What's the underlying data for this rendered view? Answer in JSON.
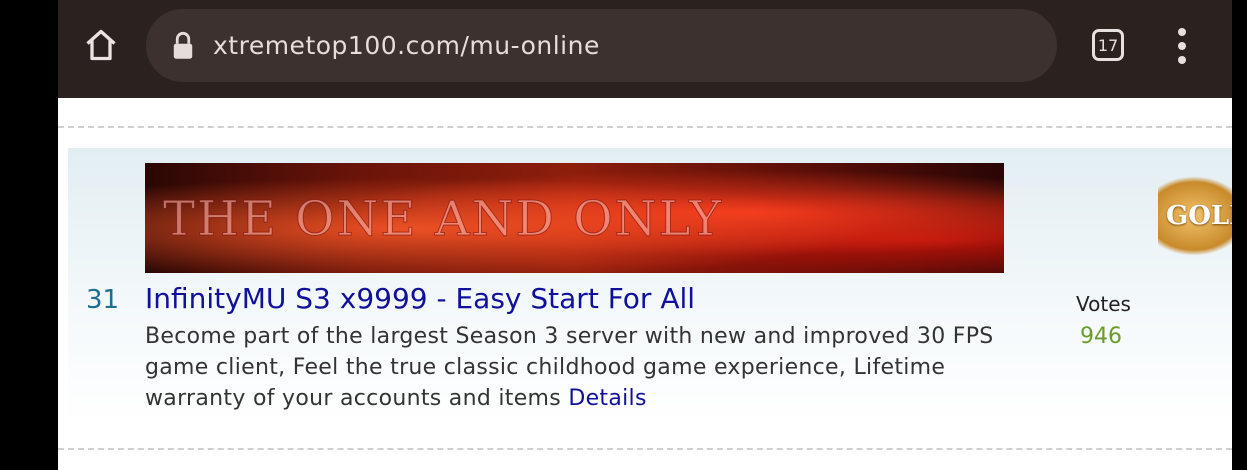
{
  "browser": {
    "url": "xtremetop100.com/mu-online",
    "tab_count": "17",
    "icons": [
      "home-icon",
      "lock-icon",
      "tab-switcher-icon",
      "more-menu-icon"
    ]
  },
  "listing": {
    "rank": "31",
    "title": "InfinityMU S3 x9999 - Easy Start For All",
    "description": "Become part of the largest Season 3 server with new and improved 30 FPS game client, Feel the true classic childhood game experience, Lifetime warranty of your accounts and items",
    "details_label": "Details",
    "banner_text": "THE ONE AND ONLY",
    "votes_label": "Votes",
    "votes_value": "946",
    "badge_text": "GOLD"
  },
  "colors": {
    "chrome_bg": "#2b211f",
    "link": "#10109a",
    "rank": "#1a6f93",
    "votes": "#6a9c2c"
  }
}
